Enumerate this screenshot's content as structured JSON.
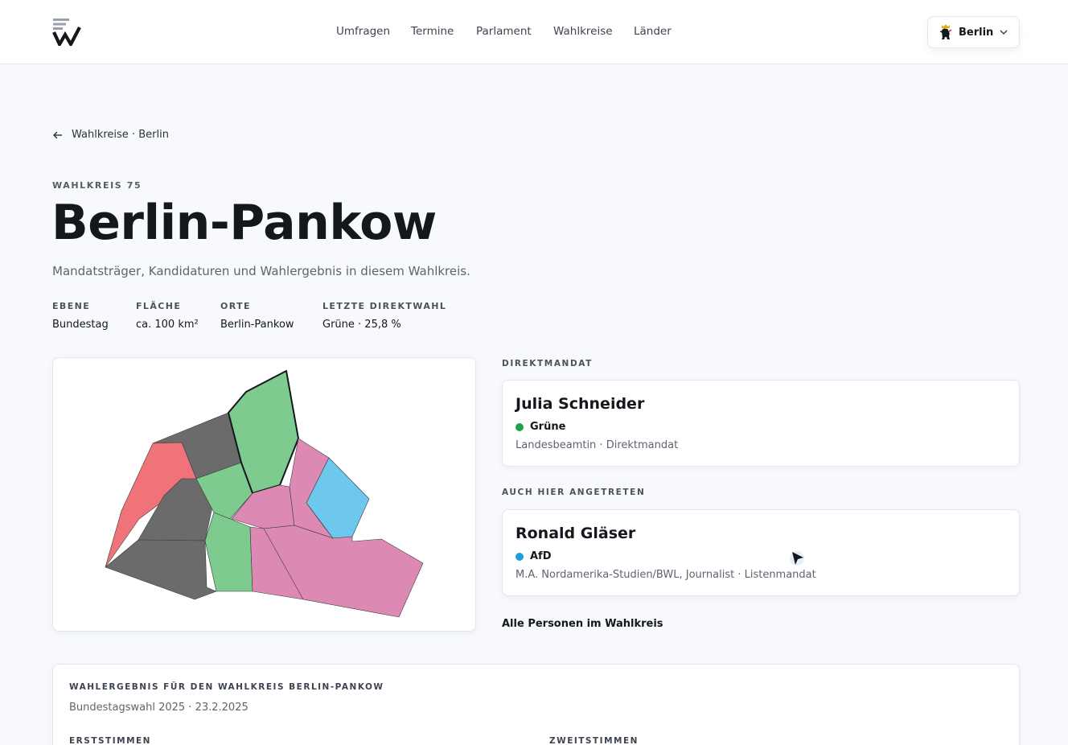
{
  "nav": {
    "items": [
      "Umfragen",
      "Termine",
      "Parlament",
      "Wahlkreise",
      "Länder"
    ],
    "state_selector": "Berlin"
  },
  "breadcrumb": "Wahlkreise · Berlin",
  "header": {
    "eyebrow": "WAHLKREIS 75",
    "title": "Berlin-Pankow",
    "subtitle": "Mandatsträger, Kandidaturen und Wahlergebnis in diesem Wahlkreis."
  },
  "meta": [
    {
      "label": "EBENE",
      "value": "Bundestag"
    },
    {
      "label": "FLÄCHE",
      "value": "ca. 100 km²"
    },
    {
      "label": "ORTE",
      "value": "Berlin-Pankow"
    },
    {
      "label": "LETZTE DIREKTWAHL",
      "value": "Grüne · 25,8 %"
    }
  ],
  "map": {
    "colors": {
      "green": "#7ecb8f",
      "gray": "#6b6b6b",
      "red": "#ef7378",
      "pink": "#dc8ab3",
      "blue": "#6ec8ee"
    }
  },
  "direktmandat": {
    "section_label": "DIREKTMANDAT",
    "name": "Julia Schneider",
    "party": "Grüne",
    "party_color": "#1fa34a",
    "role": "Landesbeamtin · Direktmandat"
  },
  "other": {
    "section_label": "AUCH HIER ANGETRETEN",
    "name": "Ronald Gläser",
    "party": "AfD",
    "party_color": "#1aa0dc",
    "role": "M.A. Nordamerika-Studien/BWL, Journalist · Listenmandat"
  },
  "all_persons_link": "Alle Personen im Wahlkreis",
  "result": {
    "title": "WAHLERGEBNIS FÜR DEN WAHLKREIS BERLIN-PANKOW",
    "subtitle": "Bundestagswahl 2025 · 23.2.2025",
    "col1": "ERSTSTIMMEN",
    "col2": "ZWEITSTIMMEN"
  }
}
